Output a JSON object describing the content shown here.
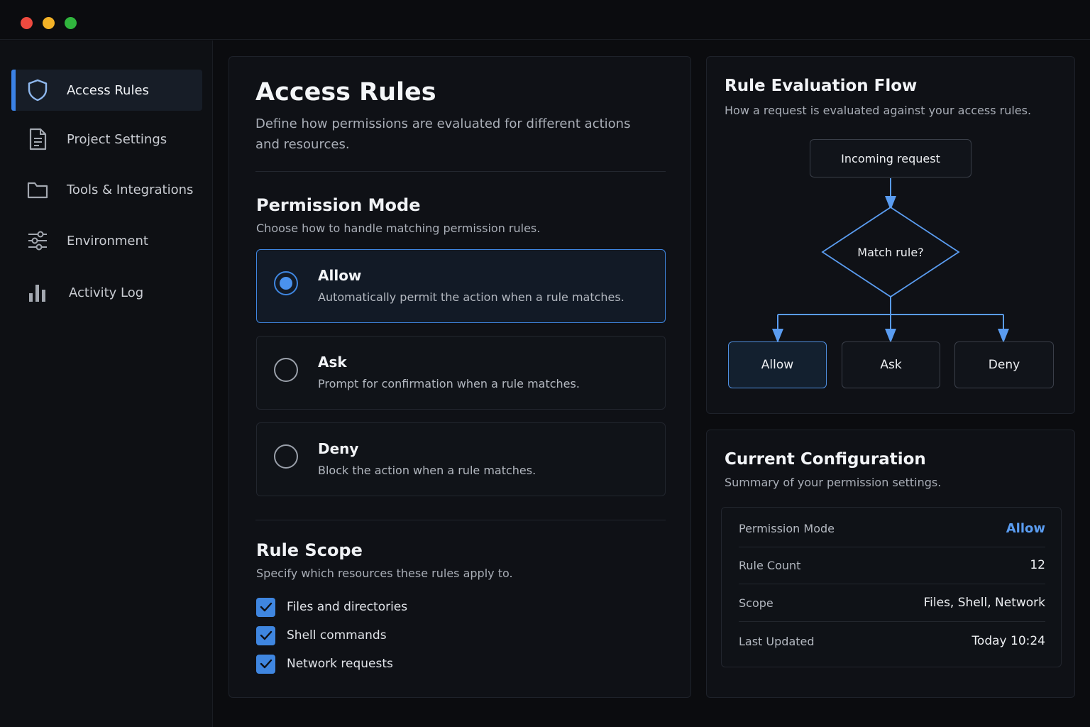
{
  "sidebar": {
    "items": [
      {
        "label": "Access Rules",
        "icon": "shield-icon",
        "active": true
      },
      {
        "label": "Project Settings",
        "icon": "document-icon"
      },
      {
        "label": "Tools & Integrations",
        "icon": "folder-icon"
      },
      {
        "label": "Environment",
        "icon": "sliders-icon"
      },
      {
        "label": "Activity Log",
        "icon": "bar-chart-icon"
      }
    ]
  },
  "main": {
    "title": "Access Rules",
    "subtitle": "Define how permissions are evaluated for different actions and resources.",
    "permission_mode": {
      "title": "Permission Mode",
      "subtitle": "Choose how to handle matching permission rules.",
      "options": [
        {
          "label": "Allow",
          "description": "Automatically permit the action when a rule matches.",
          "selected": true
        },
        {
          "label": "Ask",
          "description": "Prompt for confirmation when a rule matches."
        },
        {
          "label": "Deny",
          "description": "Block the action when a rule matches."
        }
      ]
    },
    "rule_scope": {
      "title": "Rule Scope",
      "subtitle": "Specify which resources these rules apply to.",
      "items": [
        {
          "label": "Files and directories",
          "checked": true
        },
        {
          "label": "Shell commands",
          "checked": true
        },
        {
          "label": "Network requests",
          "checked": true
        }
      ]
    }
  },
  "flow": {
    "title": "Rule Evaluation Flow",
    "subtitle": "How a request is evaluated against your access rules.",
    "start": "Incoming request",
    "decision": "Match rule?",
    "outcomes": [
      "Allow",
      "Ask",
      "Deny"
    ]
  },
  "config": {
    "title": "Current Configuration",
    "subtitle": "Summary of your permission settings.",
    "rows": [
      {
        "key": "Permission Mode",
        "value": "Allow"
      },
      {
        "key": "Rule Count",
        "value": "12"
      },
      {
        "key": "Scope",
        "value": "Files, Shell, Network"
      },
      {
        "key": "Last Updated",
        "value": "Today 10:24"
      }
    ]
  },
  "colors": {
    "accent": "#3f86e0",
    "background": "#0b0c0f",
    "card": "#0f1116"
  }
}
